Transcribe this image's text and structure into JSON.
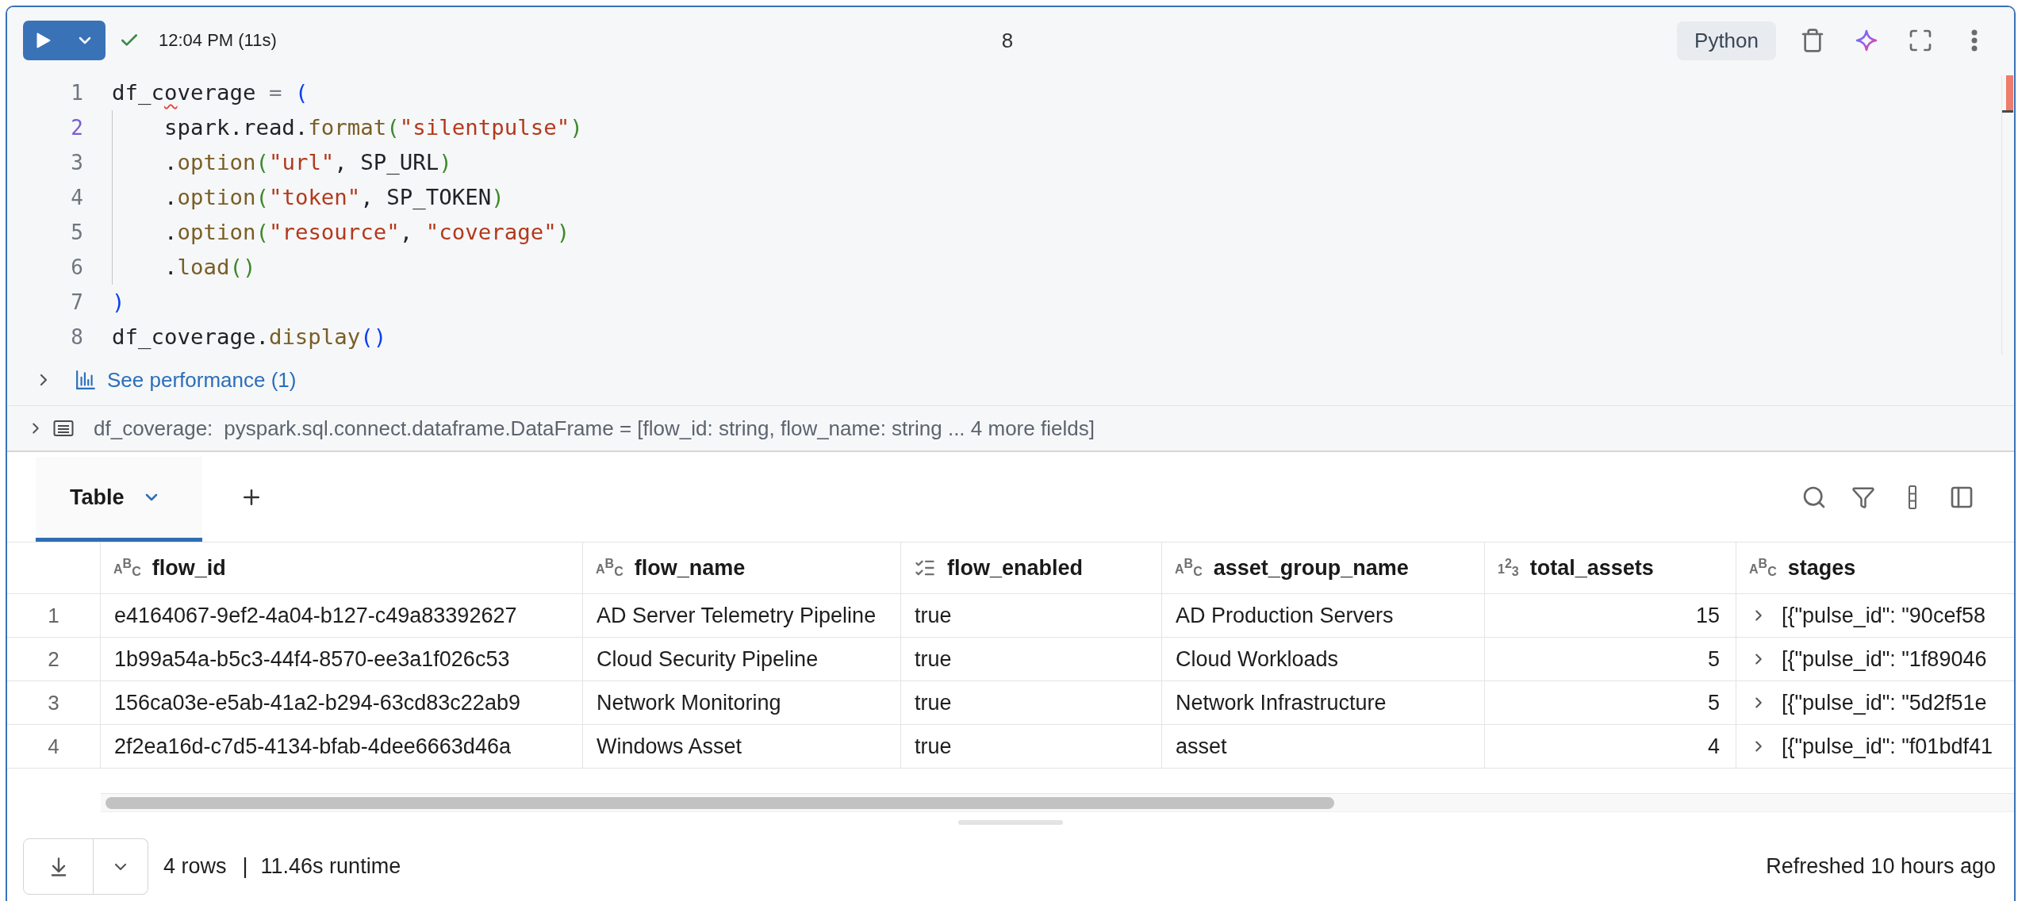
{
  "cell": {
    "run_status": {
      "kind": "success",
      "label": "12:04 PM (11s)"
    },
    "command_number": "8",
    "language": "Python",
    "code_lines": [
      {
        "number": "1",
        "active": false,
        "tokens": [
          {
            "text": "df_c",
            "kind": "plain"
          },
          {
            "text": "o",
            "kind": "flagged"
          },
          {
            "text": "verage ",
            "kind": "plain"
          },
          {
            "text": "= ",
            "kind": "operator"
          },
          {
            "text": "(",
            "kind": "bracket1"
          }
        ],
        "children": [
          {
            "number": "2",
            "active": true,
            "tokens": [
              {
                "text": "spark.read.",
                "kind": "plain"
              },
              {
                "text": "format",
                "kind": "method"
              },
              {
                "text": "(",
                "kind": "bracket2"
              },
              {
                "text": "\"silentpulse\"",
                "kind": "string"
              },
              {
                "text": ")",
                "kind": "bracket2"
              }
            ]
          },
          {
            "number": "3",
            "active": false,
            "tokens": [
              {
                "text": ".",
                "kind": "plain"
              },
              {
                "text": "option",
                "kind": "method"
              },
              {
                "text": "(",
                "kind": "bracket2"
              },
              {
                "text": "\"url\"",
                "kind": "string"
              },
              {
                "text": ", SP_URL",
                "kind": "plain"
              },
              {
                "text": ")",
                "kind": "bracket2"
              }
            ]
          },
          {
            "number": "4",
            "active": false,
            "tokens": [
              {
                "text": ".",
                "kind": "plain"
              },
              {
                "text": "option",
                "kind": "method"
              },
              {
                "text": "(",
                "kind": "bracket2"
              },
              {
                "text": "\"token\"",
                "kind": "string"
              },
              {
                "text": ", SP_TOKEN",
                "kind": "plain"
              },
              {
                "text": ")",
                "kind": "bracket2"
              }
            ]
          },
          {
            "number": "5",
            "active": false,
            "tokens": [
              {
                "text": ".",
                "kind": "plain"
              },
              {
                "text": "option",
                "kind": "method"
              },
              {
                "text": "(",
                "kind": "bracket2"
              },
              {
                "text": "\"resource\"",
                "kind": "string"
              },
              {
                "text": ", ",
                "kind": "plain"
              },
              {
                "text": "\"coverage\"",
                "kind": "string"
              },
              {
                "text": ")",
                "kind": "bracket2"
              }
            ]
          },
          {
            "number": "6",
            "active": false,
            "tokens": [
              {
                "text": ".",
                "kind": "plain"
              },
              {
                "text": "load",
                "kind": "method"
              },
              {
                "text": "()",
                "kind": "bracket2"
              }
            ]
          }
        ]
      },
      {
        "number": "7",
        "active": false,
        "tokens": [
          {
            "text": ")",
            "kind": "bracket1"
          }
        ]
      },
      {
        "number": "8",
        "active": false,
        "tokens": [
          {
            "text": "df_coverage.",
            "kind": "plain"
          },
          {
            "text": "display",
            "kind": "method"
          },
          {
            "text": "()",
            "kind": "bracket1"
          }
        ]
      }
    ],
    "performance": {
      "expanded": false,
      "label": "See performance (1)"
    },
    "schema": {
      "expanded": false,
      "variable": "df_coverage:",
      "type": "pyspark.sql.connect.dataframe.DataFrame = [flow_id: string, flow_name: string ... 4 more fields]"
    }
  },
  "results": {
    "tabs": [
      {
        "label": "Table",
        "selected": true
      }
    ],
    "table": {
      "columns": [
        {
          "name": "flow_id",
          "kind": "string",
          "type_letters": "ABC"
        },
        {
          "name": "flow_name",
          "kind": "string",
          "type_letters": "ABC"
        },
        {
          "name": "flow_enabled",
          "kind": "boolean"
        },
        {
          "name": "asset_group_name",
          "kind": "string",
          "type_letters": "ABC"
        },
        {
          "name": "total_assets",
          "kind": "number",
          "type_letters": "123"
        },
        {
          "name": "stages",
          "kind": "string",
          "type_letters": "ABC"
        }
      ],
      "rows": [
        {
          "index": "1",
          "cells": [
            {
              "text": "e4164067-9ef2-4a04-b127-c49a83392627"
            },
            {
              "text": "AD Server Telemetry Pipeline"
            },
            {
              "text": "true"
            },
            {
              "text": "AD Production Servers"
            },
            {
              "text": "15"
            },
            {
              "text": "[{\"pulse_id\": \"90cef58",
              "expanded": false
            }
          ]
        },
        {
          "index": "2",
          "cells": [
            {
              "text": "1b99a54a-b5c3-44f4-8570-ee3a1f026c53"
            },
            {
              "text": "Cloud Security Pipeline"
            },
            {
              "text": "true"
            },
            {
              "text": "Cloud Workloads"
            },
            {
              "text": "5"
            },
            {
              "text": "[{\"pulse_id\": \"1f89046",
              "expanded": false
            }
          ]
        },
        {
          "index": "3",
          "cells": [
            {
              "text": "156ca03e-e5ab-41a2-b294-63cd83c22ab9"
            },
            {
              "text": "Network Monitoring"
            },
            {
              "text": "true"
            },
            {
              "text": "Network Infrastructure"
            },
            {
              "text": "5"
            },
            {
              "text": "[{\"pulse_id\": \"5d2f51e",
              "expanded": false
            }
          ]
        },
        {
          "index": "4",
          "cells": [
            {
              "text": "2f2ea16d-c7d5-4134-bfab-4dee6663d46a"
            },
            {
              "text": "Windows Asset"
            },
            {
              "text": "true"
            },
            {
              "text": "asset"
            },
            {
              "text": "4"
            },
            {
              "text": "[{\"pulse_id\": \"f01bdf41",
              "expanded": false
            }
          ]
        }
      ]
    },
    "footer": {
      "row_count": "4 rows",
      "separator": "|",
      "runtime": "11.46s runtime",
      "refreshed": "Refreshed 10 hours ago"
    }
  }
}
